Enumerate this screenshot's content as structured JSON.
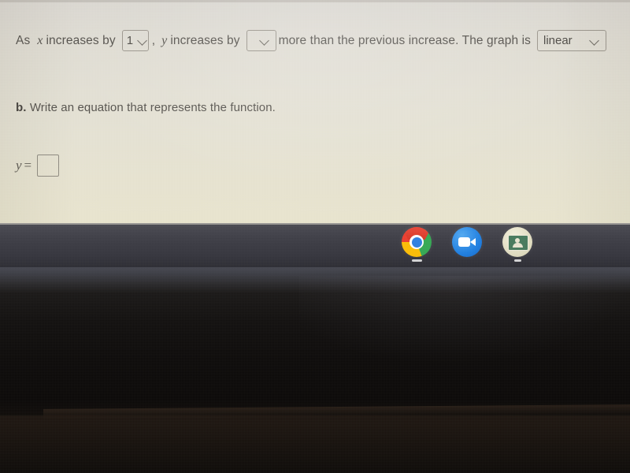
{
  "worksheet": {
    "question_a": {
      "lead_text": "As",
      "var_x": "x",
      "mid_text_1": "increases by",
      "dropdown_x_value": "1",
      "comma": ",",
      "var_y": "y",
      "mid_text_2": "increases by",
      "dropdown_y_value": "",
      "tail_text": "more than the previous increase. The graph is",
      "dropdown_graph_value": "linear"
    },
    "question_b": {
      "label": "b.",
      "text": "Write an equation that represents the function."
    },
    "answer": {
      "variable": "y",
      "equals": "=",
      "value": "",
      "placeholder": ""
    }
  },
  "shelf": {
    "apps": [
      {
        "name": "Google Chrome",
        "icon": "chrome-icon",
        "running": true
      },
      {
        "name": "Zoom",
        "icon": "zoom-video-icon",
        "running": false
      },
      {
        "name": "Google Classroom",
        "icon": "classroom-icon",
        "running": true
      }
    ]
  },
  "colors": {
    "page_background": "#e2dfd3",
    "text": "#54514c",
    "field_border": "#9a958c",
    "shelf_background": "#3d3d45",
    "bezel": "#0c0a09",
    "chrome_red": "#ea3d2f",
    "chrome_yellow": "#fbbc05",
    "chrome_green": "#34a853",
    "chrome_blue": "#2f7fe0",
    "zoom_blue": "#1e7ee0",
    "classroom_green": "#46795c"
  }
}
